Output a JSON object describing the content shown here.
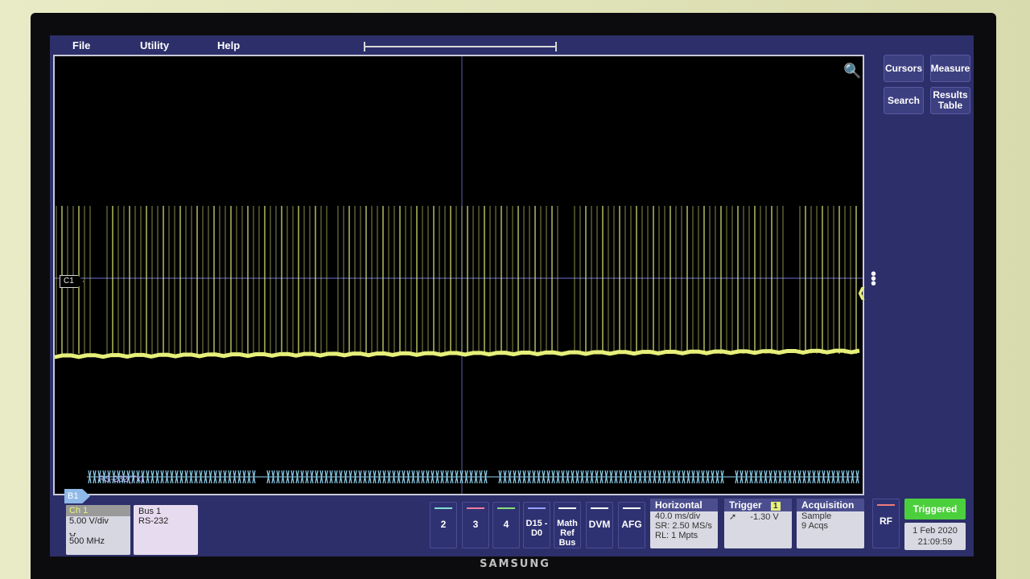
{
  "menu": {
    "file": "File",
    "utility": "Utility",
    "help": "Help"
  },
  "side_buttons": {
    "cursors": "Cursors",
    "measure": "Measure",
    "search": "Search",
    "results_table": "Results Table"
  },
  "waveform": {
    "channel_marker": "C1",
    "bus_marker": "B1",
    "bus_decode_label": "RS-232(Tx)",
    "ch1_color": "#e6f07a",
    "bus_color": "#8fd3f0"
  },
  "ch1": {
    "title": "Ch 1",
    "scale": "5.00 V/div",
    "bandwidth": "500 MHz"
  },
  "bus1": {
    "title": "Bus 1",
    "type": "RS-232"
  },
  "channel_buttons": [
    {
      "label": "2",
      "color": "#7fe0d0"
    },
    {
      "label": "3",
      "color": "#f07aa0"
    },
    {
      "label": "4",
      "color": "#88e07a"
    },
    {
      "label": "D15 -D0",
      "color": "#9aa0ff"
    },
    {
      "label": "Math Ref Bus",
      "color": "#ffffff"
    },
    {
      "label": "DVM",
      "color": "#ffffff"
    },
    {
      "label": "AFG",
      "color": "#ffffff"
    }
  ],
  "horizontal": {
    "title": "Horizontal",
    "scale": "40.0 ms/div",
    "sample_rate": "SR: 2.50 MS/s",
    "record_length": "RL: 1 Mpts"
  },
  "trigger": {
    "title": "Trigger",
    "source": "1",
    "level": "-1.30 V"
  },
  "acquisition": {
    "title": "Acquisition",
    "mode": "Sample",
    "count": "9 Acqs"
  },
  "rf": {
    "label": "RF"
  },
  "status": {
    "state": "Triggered",
    "date": "1 Feb 2020",
    "time": "21:09:59",
    "state_color": "#4ccf3c"
  },
  "brand": "SAMSUNG"
}
